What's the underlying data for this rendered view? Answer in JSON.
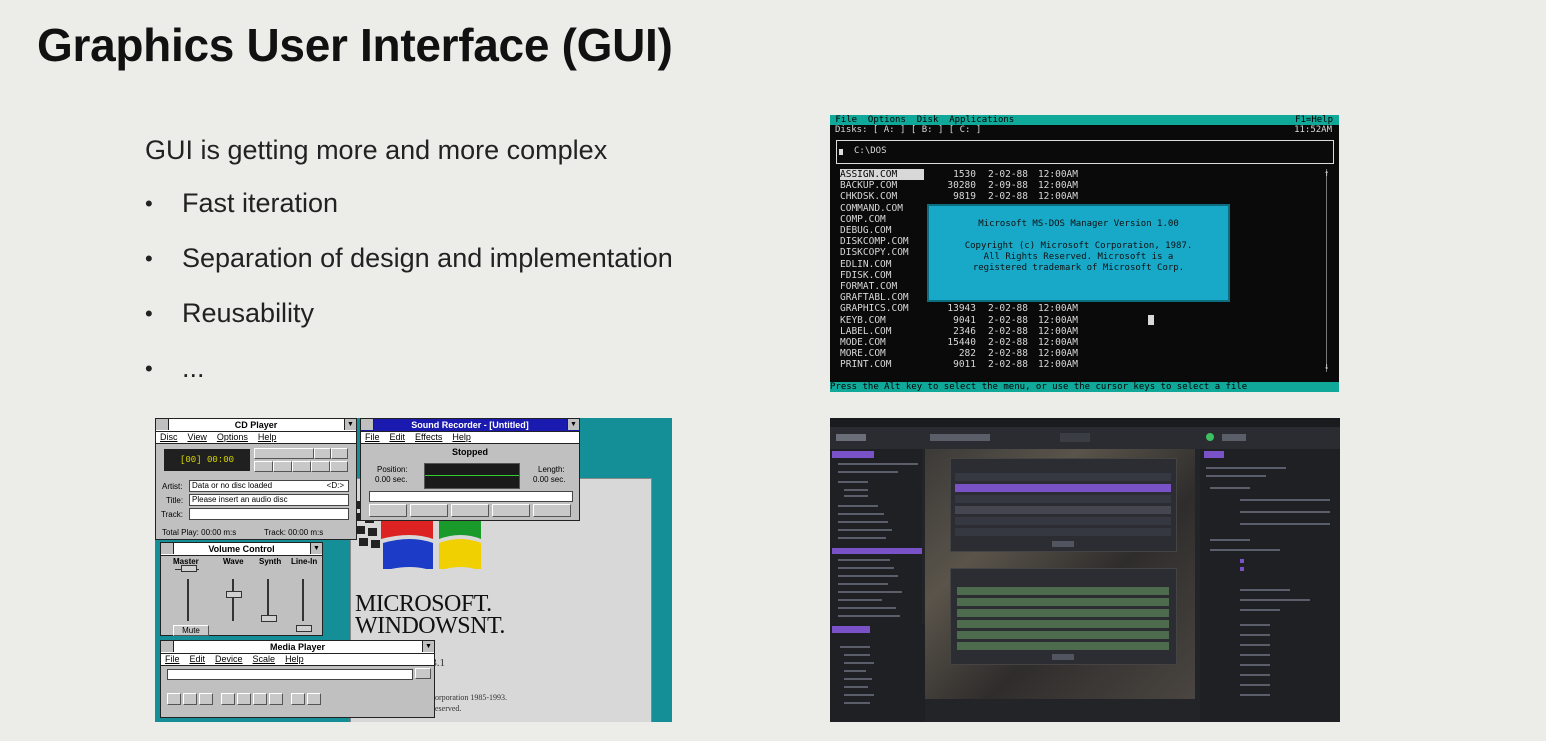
{
  "slide": {
    "title": "Graphics User Interface (GUI)",
    "intro": "GUI is getting more and more complex",
    "bullet_marker": "•",
    "bullets": [
      "Fast iteration",
      "Separation of design and implementation",
      "Reusability",
      "..."
    ]
  },
  "winnt": {
    "cd_player": {
      "title": "CD Player",
      "menu": [
        "Disc",
        "View",
        "Options",
        "Help"
      ],
      "display": "[00] 00:00",
      "artist_label": "Artist:",
      "artist_value": "Data or no disc loaded",
      "artist_drive": "<D:>",
      "title_label": "Title:",
      "title_value": "Please insert an audio disc",
      "track_label": "Track:",
      "total_play": "Total Play: 00:00 m:s",
      "track_time": "Track: 00:00 m:s"
    },
    "sound_recorder": {
      "title": "Sound Recorder - [Untitled]",
      "menu": [
        "File",
        "Edit",
        "Effects",
        "Help"
      ],
      "status": "Stopped",
      "position_label": "Position:",
      "position_value": "0.00 sec.",
      "length_label": "Length:",
      "length_value": "0.00 sec."
    },
    "volume_control": {
      "title": "Volume Control",
      "channels": [
        "Master",
        "Wave",
        "Synth",
        "Line-In"
      ],
      "mute_label": "Mute"
    },
    "media_player": {
      "title": "Media Player",
      "menu": [
        "File",
        "Edit",
        "Device",
        "Scale",
        "Help"
      ]
    },
    "splash": {
      "brand_line1": "MICROSOFT.",
      "brand_line2": "WINDOWSNT.",
      "version_fragment": "n 3.1",
      "copyright_fragment": "orporation 1985-1993.",
      "reserved_fragment": "eserved."
    }
  },
  "dos": {
    "menubar": " File  Options  Disk  Applications",
    "help_key": "F1=Help",
    "disks": "Disks: [ A: ] [ B: ] [ C: ]",
    "time": "11:52AM",
    "path": "C:\\DOS",
    "files": [
      {
        "name": "ASSIGN.COM",
        "size": "1530",
        "date": "2-02-88",
        "time": "12:00AM"
      },
      {
        "name": "BACKUP.COM",
        "size": "30280",
        "date": "2-09-88",
        "time": "12:00AM"
      },
      {
        "name": "CHKDSK.COM",
        "size": "9819",
        "date": "2-02-88",
        "time": "12:00AM"
      },
      {
        "name": "COMMAND.COM",
        "size": "",
        "date": "",
        "time": ""
      },
      {
        "name": "COMP.COM",
        "size": "",
        "date": "",
        "time": ""
      },
      {
        "name": "DEBUG.COM",
        "size": "",
        "date": "",
        "time": ""
      },
      {
        "name": "DISKCOMP.COM",
        "size": "",
        "date": "",
        "time": ""
      },
      {
        "name": "DISKCOPY.COM",
        "size": "",
        "date": "",
        "time": ""
      },
      {
        "name": "EDLIN.COM",
        "size": "",
        "date": "",
        "time": ""
      },
      {
        "name": "FDISK.COM",
        "size": "",
        "date": "",
        "time": ""
      },
      {
        "name": "FORMAT.COM",
        "size": "",
        "date": "",
        "time": ""
      },
      {
        "name": "GRAFTABL.COM",
        "size": "",
        "date": "",
        "time": ""
      },
      {
        "name": "GRAPHICS.COM",
        "size": "13943",
        "date": "2-02-88",
        "time": "12:00AM"
      },
      {
        "name": "KEYB.COM",
        "size": "9041",
        "date": "2-02-88",
        "time": "12:00AM"
      },
      {
        "name": "LABEL.COM",
        "size": "2346",
        "date": "2-02-88",
        "time": "12:00AM"
      },
      {
        "name": "MODE.COM",
        "size": "15440",
        "date": "2-02-88",
        "time": "12:00AM"
      },
      {
        "name": "MORE.COM",
        "size": "282",
        "date": "2-02-88",
        "time": "12:00AM"
      },
      {
        "name": "PRINT.COM",
        "size": "9011",
        "date": "2-02-88",
        "time": "12:00AM"
      }
    ],
    "dialog": {
      "line1": "Microsoft MS-DOS Manager Version 1.00",
      "line2": "Copyright (c) Microsoft Corporation, 1987.",
      "line3": "All Rights Reserved.  Microsoft is a",
      "line4": "registered trademark of Microsoft Corp."
    },
    "status": "Press the Alt key to select the menu, or use the cursor keys to select a file"
  },
  "colors": {
    "slide_bg": "#ecece8",
    "nt_desktop": "#148f98",
    "dos_accent": "#10a898",
    "dos_dialog": "#19a9c8",
    "editor_accent": "#7a52c8",
    "editor_green": "#4d6b4d"
  }
}
